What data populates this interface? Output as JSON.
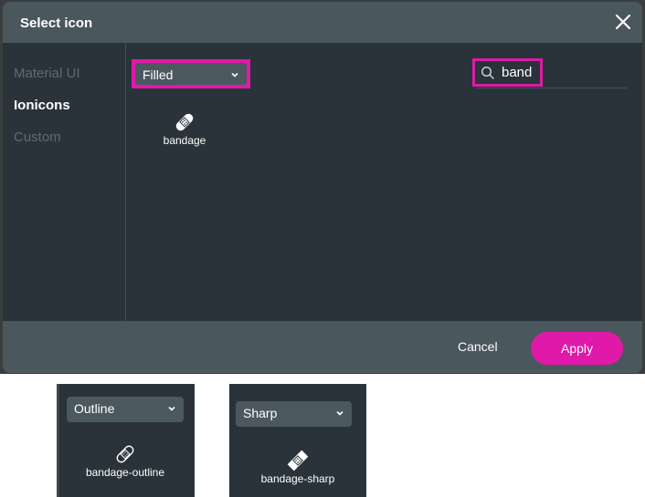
{
  "dialog": {
    "title": "Select icon",
    "close_label": "close",
    "sidebar": {
      "items": [
        {
          "label": "Material UI",
          "active": false
        },
        {
          "label": "Ionicons",
          "active": true
        },
        {
          "label": "Custom",
          "active": false
        }
      ]
    },
    "variant_select": {
      "value": "Filled"
    },
    "search": {
      "value": "band",
      "placeholder": ""
    },
    "results": [
      {
        "name": "bandage",
        "icon": "bandage-icon"
      }
    ],
    "footer": {
      "cancel_label": "Cancel",
      "apply_label": "Apply"
    },
    "colors": {
      "accent": "#e019a8",
      "header_bg": "#4a575d",
      "body_bg": "#293339"
    }
  },
  "variant_previews": [
    {
      "select_value": "Outline",
      "icon_name": "bandage-outline"
    },
    {
      "select_value": "Sharp",
      "icon_name": "bandage-sharp"
    }
  ]
}
